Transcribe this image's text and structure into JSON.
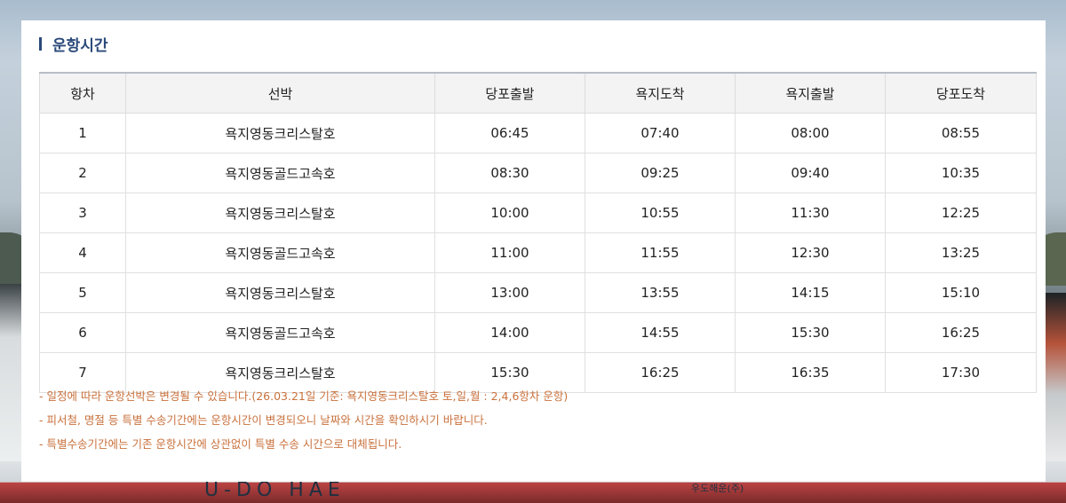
{
  "section": {
    "title": "운항시간"
  },
  "table": {
    "headers": [
      "항차",
      "선박",
      "당포출발",
      "욕지도착",
      "욕지출발",
      "당포도착"
    ],
    "rows": [
      [
        "1",
        "욕지영동크리스탈호",
        "06:45",
        "07:40",
        "08:00",
        "08:55"
      ],
      [
        "2",
        "욕지영동골드고속호",
        "08:30",
        "09:25",
        "09:40",
        "10:35"
      ],
      [
        "3",
        "욕지영동크리스탈호",
        "10:00",
        "10:55",
        "11:30",
        "12:25"
      ],
      [
        "4",
        "욕지영동골드고속호",
        "11:00",
        "11:55",
        "12:30",
        "13:25"
      ],
      [
        "5",
        "욕지영동크리스탈호",
        "13:00",
        "13:55",
        "14:15",
        "15:10"
      ],
      [
        "6",
        "욕지영동골드고속호",
        "14:00",
        "14:55",
        "15:30",
        "16:25"
      ],
      [
        "7",
        "욕지영동크리스탈호",
        "15:30",
        "16:25",
        "16:35",
        "17:30"
      ]
    ]
  },
  "notes": [
    "- 일정에 따라 운항선박은 변경될 수 있습니다.(26.03.21일 기준: 욕지영동크리스탈호 토,일,월 : 2,4,6항차 운항)",
    "- 피서철, 명절 등 특별 수송기간에는 운항시간이 변경되오니 날짜와 시간을 확인하시기 바랍니다.",
    "- 특별수송기간에는 기존 운항시간에 상관없이 특별 수송 시간으로 대체됩니다."
  ],
  "background": {
    "hull_text": "U-DO HAE",
    "hull_sub": "우도해운(주)"
  },
  "colors": {
    "title": "#2b4a7a",
    "note": "#c9713c",
    "header_bg": "#f3f3f3"
  }
}
